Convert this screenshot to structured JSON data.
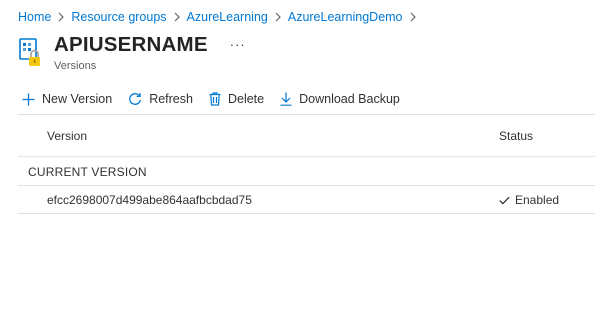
{
  "breadcrumb": [
    "Home",
    "Resource groups",
    "AzureLearning",
    "AzureLearningDemo"
  ],
  "header": {
    "title": "APIUSERNAME",
    "subtitle": "Versions",
    "more_label": "···"
  },
  "toolbar": {
    "new_version": "New Version",
    "refresh": "Refresh",
    "delete": "Delete",
    "download_backup": "Download Backup"
  },
  "table": {
    "columns": {
      "version": "Version",
      "status": "Status"
    },
    "group_label": "CURRENT VERSION",
    "rows": [
      {
        "version": "efcc2698007d499abe864aafbcbdad75",
        "status": "Enabled"
      }
    ]
  },
  "colors": {
    "link": "#0078d4",
    "accent_icon": "#0078d4",
    "lock": "#f2c811"
  }
}
